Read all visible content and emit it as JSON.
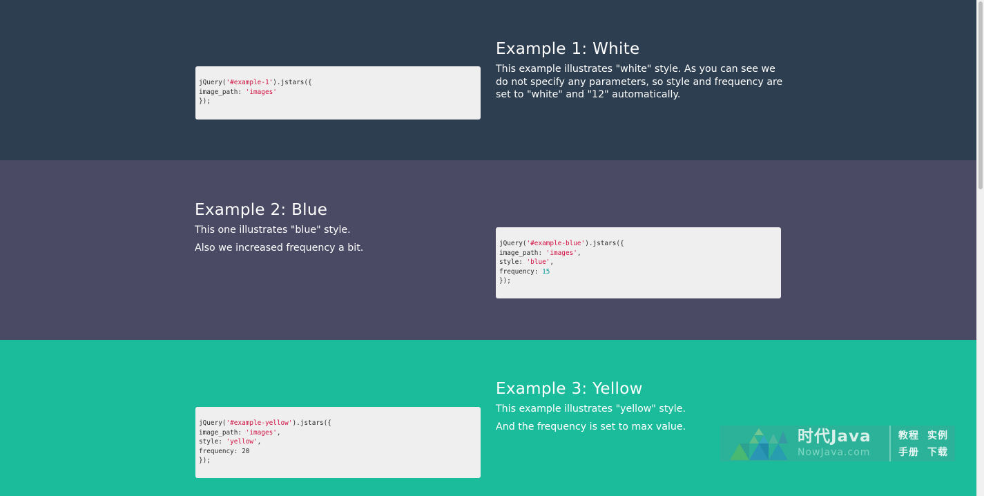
{
  "examples": [
    {
      "title": "Example 1: White",
      "paragraphs": [
        "This example illustrates \"white\" style. As you can see we do not specify any parameters, so style and frequency are set to \"white\" and \"12\" automatically."
      ],
      "code": {
        "l1_a": "jQuery(",
        "l1_b": "'#example-1'",
        "l1_c": ").jstars({",
        "l2_a": "image_path: ",
        "l2_b": "'images'",
        "l3": "});"
      }
    },
    {
      "title": "Example 2: Blue",
      "paragraphs": [
        "This one illustrates \"blue\" style.",
        "Also we increased frequency a bit."
      ],
      "code": {
        "l1_a": "jQuery(",
        "l1_b": "'#example-blue'",
        "l1_c": ").jstars({",
        "l2_a": "image_path: ",
        "l2_b": "'images'",
        "l2_c": ",",
        "l3_a": "style: ",
        "l3_b": "'blue'",
        "l3_c": ",",
        "l4_a": "frequency: ",
        "l4_b": "15",
        "l5": "});"
      }
    },
    {
      "title": "Example 3: Yellow",
      "paragraphs": [
        "This example illustrates \"yellow\" style.",
        "And the frequency is set to max value."
      ],
      "code": {
        "l1_a": "jQuery(",
        "l1_b": "'#example-yellow'",
        "l1_c": ").jstars({",
        "l2_a": "image_path: ",
        "l2_b": "'images'",
        "l2_c": ",",
        "l3_a": "style: ",
        "l3_b": "'yellow'",
        "l3_c": ",",
        "l4_a": "frequency: ",
        "l4_b": "20",
        "l5": "});"
      }
    }
  ],
  "watermark": {
    "brand": "时代Java",
    "sub": "NowJava.com",
    "links": [
      "教程",
      "实例",
      "手册",
      "下载"
    ]
  },
  "colors": {
    "section1_bg": "#2d3e50",
    "section2_bg": "#4b4a64",
    "section3_bg": "#1abc9c",
    "code_bg": "#efefef",
    "code_string": "#d01040",
    "code_number": "#009999"
  }
}
